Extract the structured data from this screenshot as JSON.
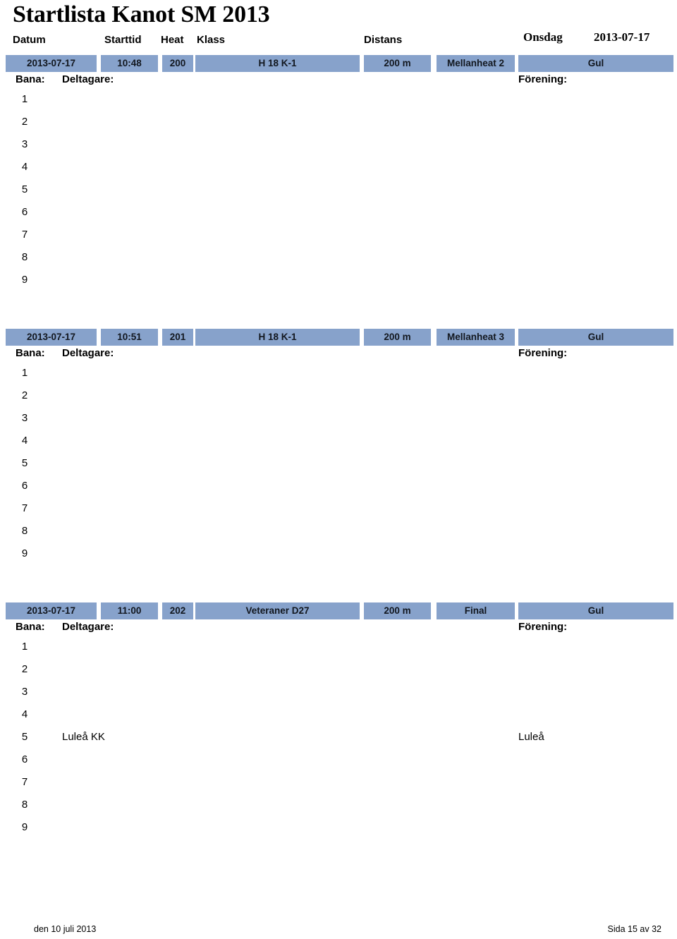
{
  "document": {
    "title": "Startlista Kanot SM 2013"
  },
  "column_headers": {
    "datum": "Datum",
    "starttid": "Starttid",
    "heat": "Heat",
    "klass": "Klass",
    "distans": "Distans",
    "weekday": "Onsdag",
    "date": "2013-07-17"
  },
  "row_labels": {
    "bana": "Bana:",
    "deltagare": "Deltagare:",
    "forening": "Förening:"
  },
  "heats": [
    {
      "datum": "2013-07-17",
      "starttid": "10:48",
      "heat": "200",
      "klass": "H 18  K-1",
      "distans": "200 m",
      "omgang": "Mellanheat 2",
      "bana_farg": "Gul",
      "lanes": [
        {
          "num": "1",
          "deltagare": "",
          "forening": ""
        },
        {
          "num": "2",
          "deltagare": "",
          "forening": ""
        },
        {
          "num": "3",
          "deltagare": "",
          "forening": ""
        },
        {
          "num": "4",
          "deltagare": "",
          "forening": ""
        },
        {
          "num": "5",
          "deltagare": "",
          "forening": ""
        },
        {
          "num": "6",
          "deltagare": "",
          "forening": ""
        },
        {
          "num": "7",
          "deltagare": "",
          "forening": ""
        },
        {
          "num": "8",
          "deltagare": "",
          "forening": ""
        },
        {
          "num": "9",
          "deltagare": "",
          "forening": ""
        }
      ]
    },
    {
      "datum": "2013-07-17",
      "starttid": "10:51",
      "heat": "201",
      "klass": "H 18  K-1",
      "distans": "200 m",
      "omgang": "Mellanheat 3",
      "bana_farg": "Gul",
      "lanes": [
        {
          "num": "1",
          "deltagare": "",
          "forening": ""
        },
        {
          "num": "2",
          "deltagare": "",
          "forening": ""
        },
        {
          "num": "3",
          "deltagare": "",
          "forening": ""
        },
        {
          "num": "4",
          "deltagare": "",
          "forening": ""
        },
        {
          "num": "5",
          "deltagare": "",
          "forening": ""
        },
        {
          "num": "6",
          "deltagare": "",
          "forening": ""
        },
        {
          "num": "7",
          "deltagare": "",
          "forening": ""
        },
        {
          "num": "8",
          "deltagare": "",
          "forening": ""
        },
        {
          "num": "9",
          "deltagare": "",
          "forening": ""
        }
      ]
    },
    {
      "datum": "2013-07-17",
      "starttid": "11:00",
      "heat": "202",
      "klass": "Veteraner D27",
      "distans": "200 m",
      "omgang": "Final",
      "bana_farg": "Gul",
      "lanes": [
        {
          "num": "1",
          "deltagare": "",
          "forening": ""
        },
        {
          "num": "2",
          "deltagare": "",
          "forening": ""
        },
        {
          "num": "3",
          "deltagare": "",
          "forening": ""
        },
        {
          "num": "4",
          "deltagare": "",
          "forening": ""
        },
        {
          "num": "5",
          "deltagare": "Luleå KK",
          "forening": "Luleå"
        },
        {
          "num": "6",
          "deltagare": "",
          "forening": ""
        },
        {
          "num": "7",
          "deltagare": "",
          "forening": ""
        },
        {
          "num": "8",
          "deltagare": "",
          "forening": ""
        },
        {
          "num": "9",
          "deltagare": "",
          "forening": ""
        }
      ]
    }
  ],
  "footer": {
    "printed_date": "den 10 juli 2013",
    "page": "Sida 15 av 32"
  },
  "colors": {
    "bar_blue": "#87A2CB",
    "text": "#000000",
    "background": "#ffffff"
  }
}
